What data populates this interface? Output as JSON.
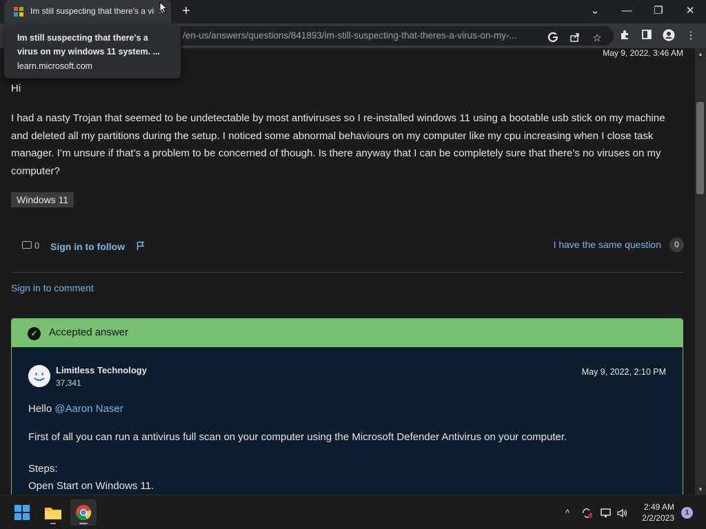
{
  "browser": {
    "tab_title": "Im still suspecting that there's a virus",
    "tab_close_glyph": "×",
    "new_tab_glyph": "+",
    "url": "/en-us/answers/questions/841893/im-still-suspecting-that-theres-a-virus-on-my-...",
    "window_controls": {
      "dropdown": "⌄",
      "minimize": "—",
      "restore": "❐",
      "close": "✕"
    },
    "tooltip": {
      "title": "Im still suspecting that there's a virus on my windows 11 system. ...",
      "domain": "learn.microsoft.com"
    }
  },
  "question": {
    "date": "May 9, 2022, 3:46 AM",
    "greeting": "Hi",
    "body": "I had a nasty Trojan that seemed to be undetectable by most antiviruses so I re-installed windows 11 using a bootable usb stick on my machine and deleted all my partitions during the setup. I noticed some abnormal behaviours on my computer like my cpu increasing when I close task manager. I’m unsure if that’s a problem to be concerned of though. Is there anyway that I can be completely sure that there’s no viruses on my computer?",
    "tag": "Windows 11",
    "comment_count": "0",
    "follow_label": "Sign in to follow",
    "same_question_label": "I have the same question",
    "same_question_count": "0",
    "sign_in_comment": "Sign in to comment"
  },
  "answer": {
    "header": "Accepted answer",
    "author": "Limitless Technology",
    "reputation": "37,341",
    "date": "May 9, 2022, 2:10 PM",
    "hello": "Hello",
    "mention": "@Aaron Naser",
    "paragraph": "First of all you can run a antivirus full scan on your computer using the Microsoft Defender Antivirus on your computer.",
    "steps_label": "Steps:",
    "step1": "Open Start on Windows 11."
  },
  "taskbar": {
    "time": "2:49 AM",
    "date": "2/2/2023",
    "notification_count": "1",
    "tray_chevron": "^"
  },
  "colors": {
    "link": "#75b6e7",
    "accepted_green": "#7ac073",
    "answer_bg": "#0c1e2d",
    "page_bg": "#1b1b1b"
  }
}
